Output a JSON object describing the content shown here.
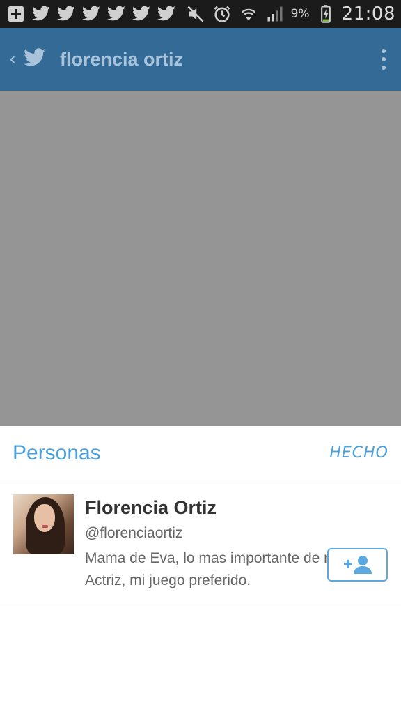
{
  "status_bar": {
    "icons": [
      "add-notification-icon",
      "twitter-notification-icon",
      "twitter-notification-icon",
      "twitter-notification-icon",
      "twitter-notification-icon",
      "twitter-notification-icon",
      "twitter-notification-icon",
      "mute-icon",
      "alarm-icon",
      "wifi-icon",
      "signal-icon"
    ],
    "battery_percent": "9%",
    "time": "21:08"
  },
  "header": {
    "title": "florencia ortiz"
  },
  "sheet": {
    "title": "Personas",
    "done_label": "HECHO",
    "user": {
      "name": "Florencia Ortiz",
      "handle": "@florenciaortiz",
      "bio": "Mama de Eva, lo mas importante de mi vida. Actriz, mi juego preferido."
    }
  },
  "colors": {
    "header_bg": "#336b96",
    "accent": "#4a9fdc",
    "dim_overlay": "#959595"
  }
}
